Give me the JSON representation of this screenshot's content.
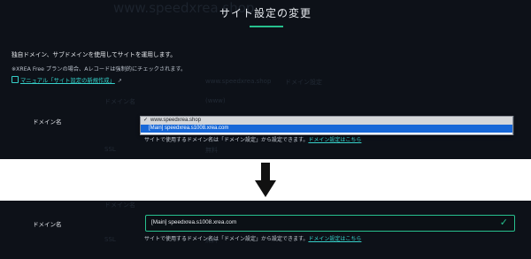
{
  "header": {
    "title": "サイト設定の変更",
    "bg_site": "www.speedxrea.shop"
  },
  "intro": {
    "text": "独自ドメイン、サブドメインを使用してサイトを運用します。",
    "note": "※XREA Free プランの場合、Aレコードは強制的にチェックされます。",
    "manual_link": "マニュアル「サイト設定の新規作成」",
    "manual_icon": "book-icon",
    "external_icon": "external-link-icon"
  },
  "domain_field": {
    "label": "ドメイン名",
    "options": [
      "www.speedxrea.shop",
      "[Main] speedxrea.s1008.xrea.com"
    ],
    "current_value": "www.speedxrea.shop",
    "highlighted_option": "[Main] speedxrea.s1008.xrea.com",
    "help_text": "サイトで使用するドメイン名は「ドメイン設定」から設定できます。",
    "help_link": "ドメイン設定はこちら"
  },
  "arrow_icon": "down-arrow-icon",
  "result": {
    "label": "ドメイン名",
    "value": "[Main] speedxrea.s1008.xrea.com",
    "valid_icon": "check-icon",
    "help_text": "サイトで使用するドメイン名は「ドメイン設定」から設定できます。",
    "help_link": "ドメイン設定はこちら"
  },
  "colors": {
    "background": "#0d1118",
    "accent": "#27c08e",
    "link": "#36d0c9",
    "highlight": "#1868d8"
  }
}
